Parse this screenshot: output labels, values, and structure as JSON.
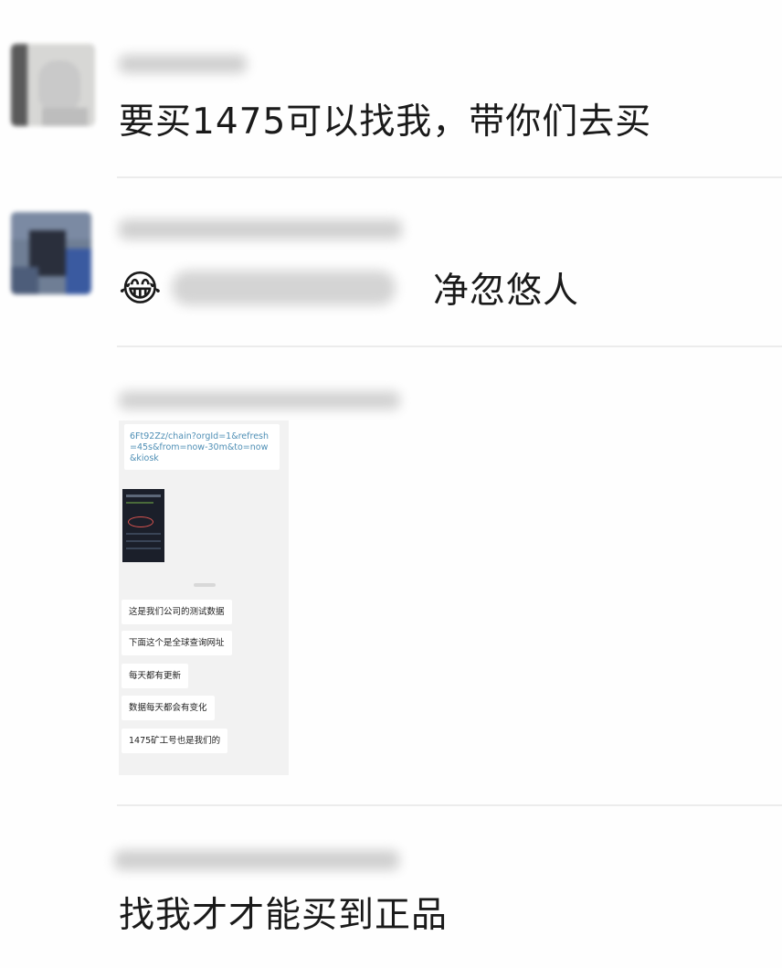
{
  "comments": [
    {
      "text": "要买1475可以找我，带你们去买"
    },
    {
      "emoji": "😂",
      "text": "净忽悠人"
    },
    {
      "screenshot": {
        "url_text": "6Ft92Zz/chain?orgId=1&refresh=45s&from=now-30m&to=now&kiosk",
        "messages": [
          "这是我们公司的测试数据",
          "下面这个是全球查询网址",
          "每天都有更新",
          "数据每天都会有变化",
          "1475矿工号也是我们的"
        ]
      }
    },
    {
      "text": "找我才才能买到正品"
    }
  ]
}
